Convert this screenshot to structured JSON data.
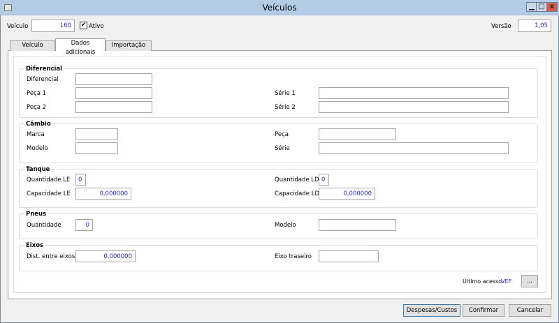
{
  "window": {
    "title": "Veículos",
    "minimize": "▁",
    "maximize": "□",
    "close": "x"
  },
  "header": {
    "veiculo_label": "Veículo",
    "veiculo_value": "160",
    "ativo_label": "Ativo",
    "ativo_checked": true,
    "check_mark": "✔",
    "versao_label": "Versão",
    "versao_value": "1,05"
  },
  "tabs": [
    {
      "label": "Veículo"
    },
    {
      "label": "Dados adicionais",
      "active": true
    },
    {
      "label": "Importação"
    }
  ],
  "diferencial": {
    "title": "Diferencial",
    "diferencial_label": "Diferencial",
    "peca1_label": "Peça 1",
    "peca2_label": "Peça 2",
    "serie1_label": "Série 1",
    "serie2_label": "Série 2",
    "diferencial_value": "",
    "peca1_value": "",
    "peca2_value": "",
    "serie1_value": "",
    "serie2_value": ""
  },
  "cambio": {
    "title": "Câmbio",
    "marca_label": "Marca",
    "modelo_label": "Modelo",
    "peca_label": "Peça",
    "serie_label": "Série"
  },
  "tanque": {
    "title": "Tanque",
    "qtd_le_label": "Quantidade LE",
    "qtd_le_value": "0",
    "qtd_ld_label": "Quantidade LD",
    "qtd_ld_value": "0",
    "cap_le_label": "Capacidade LE",
    "cap_le_value": "0,000000",
    "cap_ld_label": "Capacidade LD",
    "cap_ld_value": "0,000000"
  },
  "pneus": {
    "title": "Pneus",
    "quantidade_label": "Quantidade",
    "quantidade_value": "0",
    "modelo_label": "Modelo"
  },
  "eixos": {
    "title": "Eixos",
    "dist_label": "Dist. entre eixos",
    "dist_value": "0,000000",
    "traseiro_label": "Eixo traseiro"
  },
  "footer": {
    "ultimo_acesso_label": "Último acesso",
    "ultimo_acesso_value": "VEF",
    "ellipsis_label": "...",
    "despesas_label": "Despesas/Custos",
    "confirmar_label": "Confirmar",
    "cancelar_label": "Cancelar"
  }
}
